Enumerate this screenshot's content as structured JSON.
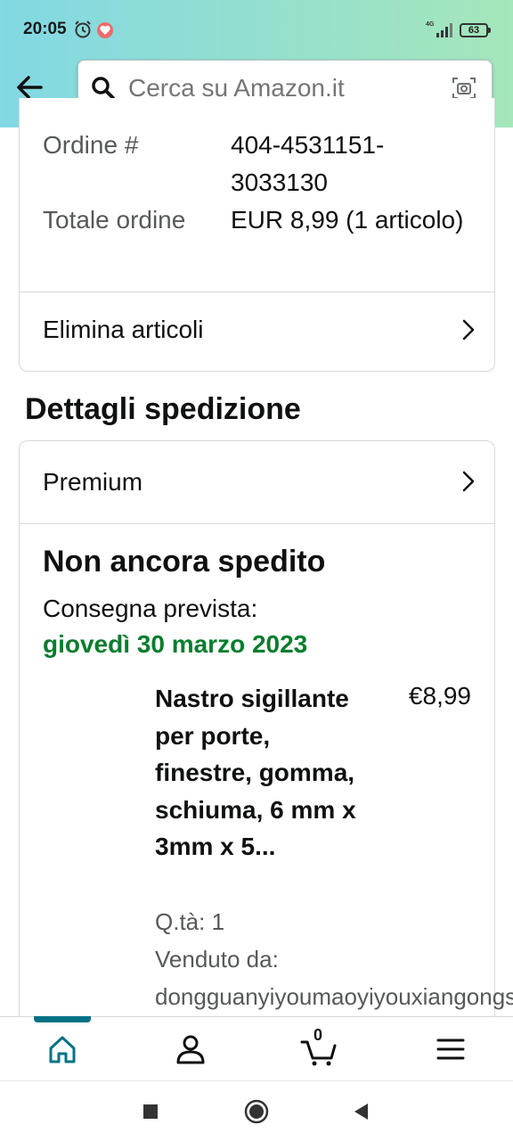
{
  "status_bar": {
    "time": "20:05",
    "network": "4G",
    "battery": "63"
  },
  "search": {
    "placeholder": "Cerca su Amazon.it"
  },
  "order": {
    "number_label": "Ordine #",
    "number_value": "404-4531151-3033130",
    "total_label": "Totale ordine",
    "total_value": "EUR 8,99 (1 articolo)",
    "delete_items_label": "Elimina articoli"
  },
  "shipping": {
    "section_title": "Dettagli spedizione",
    "service_label": "Premium",
    "status_title": "Non ancora spedito",
    "delivery_label": "Consegna prevista:",
    "delivery_date": "giovedì 30 marzo 2023",
    "product": {
      "title": "Nastro sigillante per porte, finestre, gomma, schiuma, 6 mm x 3mm x 5...",
      "price": "€8,99",
      "quantity": "Q.tà: 1",
      "sold_by_label": "Venduto da:",
      "seller": "dongguanyiyoumaoyiyouxiangongsi"
    }
  },
  "bottom_nav": {
    "cart_count": "0"
  },
  "colors": {
    "accent": "#007185",
    "delivery_green": "#067d2d",
    "header_start": "#82d8e3",
    "header_end": "#a5e6ba"
  }
}
